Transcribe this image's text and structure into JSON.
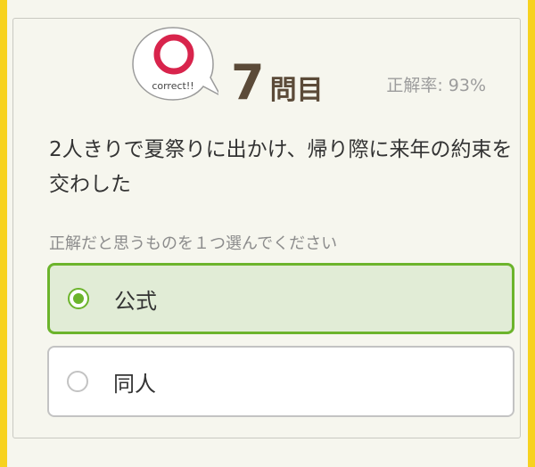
{
  "result": {
    "badge_text": "correct!!",
    "mark_color": "#d8244c"
  },
  "question": {
    "number": "7",
    "number_suffix": "問目",
    "accuracy": "正解率: 93%",
    "text": "2人きりで夏祭りに出かけ、帰り際に来年の約束を交わした",
    "instruction": "正解だと思うものを１つ選んでください"
  },
  "options": [
    {
      "label": "公式",
      "selected": true
    },
    {
      "label": "同人",
      "selected": false
    }
  ],
  "colors": {
    "frame": "#f7d21f",
    "accent_green": "#6cb42c",
    "selected_bg": "#e1ecd6",
    "number_brown": "#5b4a38"
  }
}
